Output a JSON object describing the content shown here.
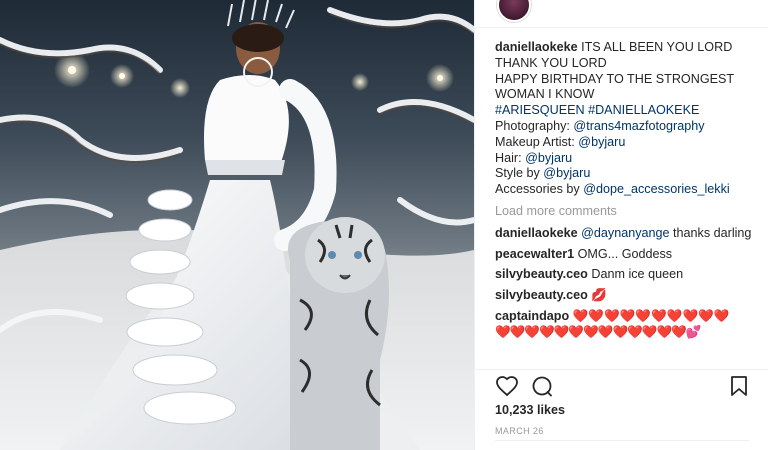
{
  "post": {
    "username": "daniellaokeke",
    "caption_lines": [
      {
        "text": "ITS ALL BEEN YOU LORD",
        "kind": "text"
      },
      {
        "text": "THANK YOU LORD",
        "kind": "text"
      },
      {
        "text": "HAPPY BIRTHDAY TO THE STRONGEST",
        "kind": "text"
      },
      {
        "text": "WOMAN I KNOW",
        "kind": "text"
      }
    ],
    "hashtags": "#ARIESQUEEN #DANIELLAOKEKE",
    "credits": [
      {
        "label": "Photography: ",
        "handle": "@trans4mazfotography"
      },
      {
        "label": "Makeup Artist: ",
        "handle": "@byjaru"
      },
      {
        "label": "Hair: ",
        "handle": "@byjaru"
      },
      {
        "label": "Style by ",
        "handle": "@byjaru"
      },
      {
        "label": "Accessories by ",
        "handle": "@dope_accessories_lekki"
      }
    ]
  },
  "load_more": "Load more comments",
  "comments": [
    {
      "user": "daniellaokeke",
      "mention": "@daynanyange",
      "text": " thanks darling"
    },
    {
      "user": "peacewalter1",
      "mention": "",
      "text": " OMG... Goddess"
    },
    {
      "user": "silvybeauty.ceo",
      "mention": "",
      "text": " Danm ice queen"
    },
    {
      "user": "silvybeauty.ceo",
      "mention": "",
      "text": " 💋"
    },
    {
      "user": "captaindapo",
      "mention": "",
      "text": " ❤️❤️❤️❤️❤️❤️❤️❤️❤️❤️"
    }
  ],
  "emoji_continuation": "❤️❤️❤️❤️❤️❤️❤️❤️❤️❤️❤️❤️❤️💕",
  "likes": "10,233 likes",
  "date": "MARCH 26",
  "icons": {
    "like": "heart-icon",
    "comment": "comment-icon",
    "save": "bookmark-icon"
  },
  "colors": {
    "link": "#003569",
    "muted": "#999999",
    "text": "#262626",
    "divider": "#efefef"
  }
}
